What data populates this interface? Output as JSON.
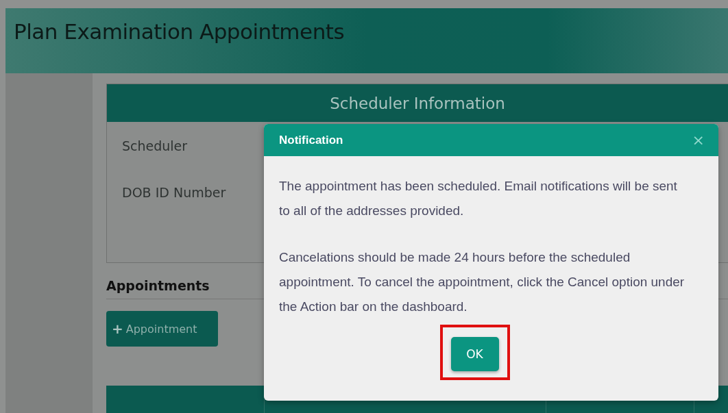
{
  "page": {
    "title": "Plan Examination Appointments"
  },
  "scheduler_card": {
    "title": "Scheduler Information",
    "fields": [
      {
        "label": "Scheduler"
      },
      {
        "label": "DOB ID Number"
      }
    ]
  },
  "appointments": {
    "heading": "Appointments",
    "add_button": {
      "icon": "+",
      "label": "Appointment"
    }
  },
  "dialog": {
    "title": "Notification",
    "close": "×",
    "paragraphs": [
      "The appointment has been scheduled. Email notifications will be sent to all of the addresses provided.",
      "Cancelations should be made 24 hours before the scheduled appointment. To cancel the appointment, click the Cancel option under the Action bar on the dashboard."
    ],
    "button": {
      "label": "OK",
      "highlighted": true
    }
  }
}
